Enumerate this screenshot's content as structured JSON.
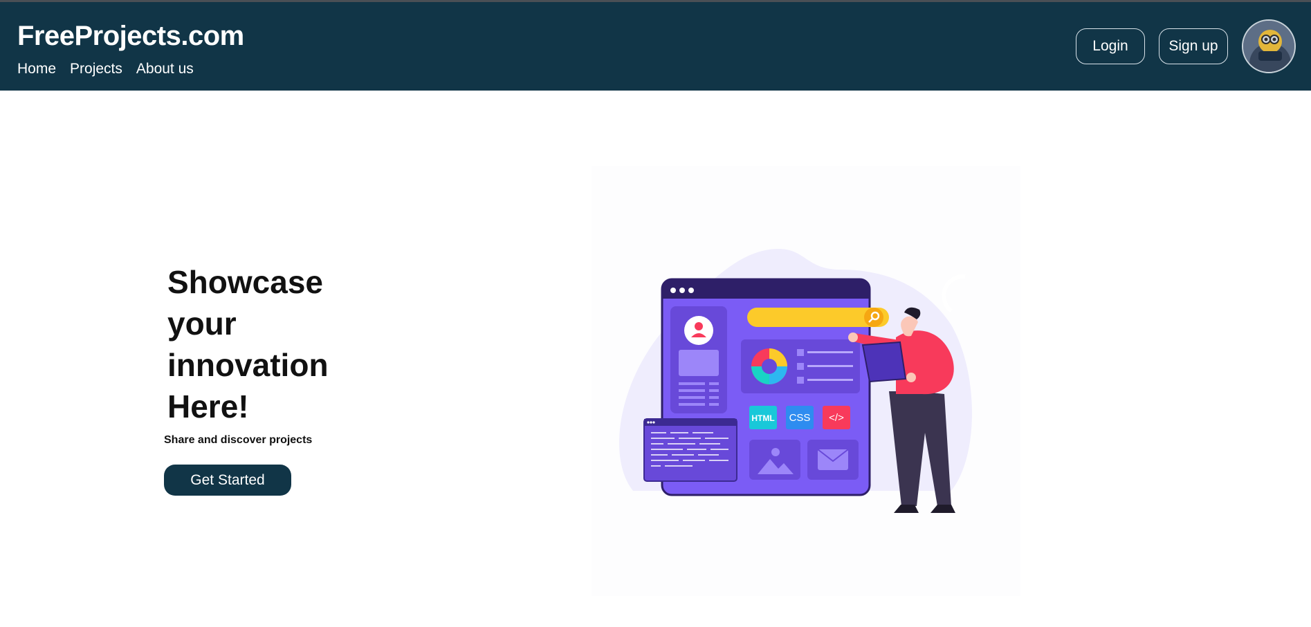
{
  "header": {
    "brand": "FreeProjects.com",
    "nav": [
      {
        "label": "Home"
      },
      {
        "label": "Projects"
      },
      {
        "label": "About us"
      }
    ],
    "login_label": "Login",
    "signup_label": "Sign up"
  },
  "hero": {
    "title_lines": [
      "Showcase",
      "your",
      "innovation",
      "Here!"
    ],
    "subtitle": "Share and discover projects",
    "cta_label": "Get Started"
  },
  "illustration": {
    "tags": [
      "HTML",
      "CSS",
      "</>"
    ]
  },
  "colors": {
    "header_bg": "#113547",
    "accent_purple": "#7b5cf5",
    "search_yellow": "#fcca2a",
    "shirt_red": "#f83a5b"
  }
}
